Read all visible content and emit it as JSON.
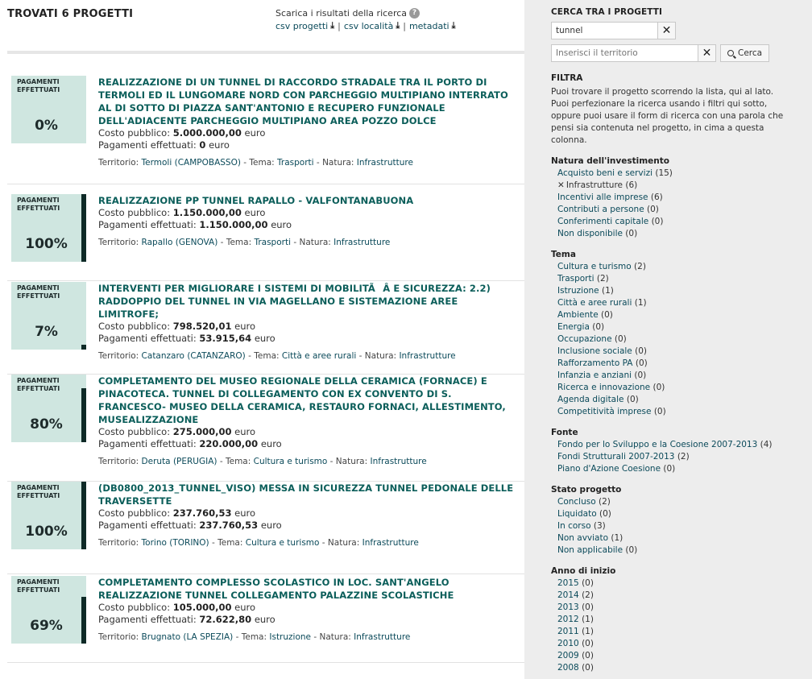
{
  "results": {
    "title": "TROVATI 6 PROGETTI",
    "download_label": "Scarica i risultati della ricerca",
    "help_icon": "?",
    "downloads": [
      {
        "label": "csv progetti",
        "icon": "download-icon"
      },
      {
        "label": "csv località",
        "icon": "download-icon"
      },
      {
        "label": "metadati",
        "icon": "download-icon"
      }
    ],
    "separator": "|"
  },
  "projects": [
    {
      "pct_label": "PAGAMENTI EFFETTUATI",
      "pct_text": "0%",
      "pct": 0,
      "title": "REALIZZAZIONE DI UN TUNNEL DI RACCORDO STRADALE TRA IL PORTO DI TERMOLI ED IL LUNGOMARE NORD CON PARCHEGGIO MULTIPIANO INTERRATO AL DI SOTTO DI PIAZZA SANT'ANTONIO E RECUPERO FUNZIONALE DELL'ADIACENTE PARCHEGGIO MULTIPIANO AREA POZZO DOLCE",
      "cost_label": "Costo pubblico:",
      "cost": "5.000.000,00",
      "paid_label": "Pagamenti effettuati:",
      "paid": "0",
      "currency": "euro",
      "territory_label": "Territorio:",
      "territory": "Termoli (CAMPOBASSO)",
      "theme_label": "Tema:",
      "theme": "Trasporti",
      "nature_label": "Natura:",
      "nature": "Infrastrutture"
    },
    {
      "pct_label": "PAGAMENTI EFFETTUATI",
      "pct_text": "100%",
      "pct": 100,
      "title": "REALIZZAZIONE PP TUNNEL RAPALLO - VALFONTANABUONA",
      "cost_label": "Costo pubblico:",
      "cost": "1.150.000,00",
      "paid_label": "Pagamenti effettuati:",
      "paid": "1.150.000,00",
      "currency": "euro",
      "territory_label": "Territorio:",
      "territory": "Rapallo (GENOVA)",
      "theme_label": "Tema:",
      "theme": "Trasporti",
      "nature_label": "Natura:",
      "nature": "Infrastrutture"
    },
    {
      "pct_label": "PAGAMENTI EFFETTUATI",
      "pct_text": "7%",
      "pct": 7,
      "title": "INTERVENTI PER MIGLIORARE I SISTEMI DI MOBILITÃÂ  E SICUREZZA: 2.2) RADDOPPIO DEL TUNNEL IN VIA MAGELLANO E SISTEMAZIONE AREE LIMITROFE;",
      "cost_label": "Costo pubblico:",
      "cost": "798.520,01",
      "paid_label": "Pagamenti effettuati:",
      "paid": "53.915,64",
      "currency": "euro",
      "territory_label": "Territorio:",
      "territory": "Catanzaro (CATANZARO)",
      "theme_label": "Tema:",
      "theme": "Città e aree rurali",
      "nature_label": "Natura:",
      "nature": "Infrastrutture"
    },
    {
      "pct_label": "PAGAMENTI EFFETTUATI",
      "pct_text": "80%",
      "pct": 80,
      "title": "COMPLETAMENTO DEL MUSEO REGIONALE DELLA CERAMICA (FORNACE) E PINACOTECA. TUNNEL DI COLLEGAMENTO CON EX CONVENTO DI S. FRANCESCO- MUSEO DELLA CERAMICA, RESTAURO FORNACI, ALLESTIMENTO, MUSEALIZZAZIONE",
      "cost_label": "Costo pubblico:",
      "cost": "275.000,00",
      "paid_label": "Pagamenti effettuati:",
      "paid": "220.000,00",
      "currency": "euro",
      "territory_label": "Territorio:",
      "territory": "Deruta (PERUGIA)",
      "theme_label": "Tema:",
      "theme": "Cultura e turismo",
      "nature_label": "Natura:",
      "nature": "Infrastrutture"
    },
    {
      "pct_label": "PAGAMENTI EFFETTUATI",
      "pct_text": "100%",
      "pct": 100,
      "title": "(DB0800_2013_TUNNEL_VISO) MESSA IN SICUREZZA TUNNEL PEDONALE DELLE TRAVERSETTE",
      "cost_label": "Costo pubblico:",
      "cost": "237.760,53",
      "paid_label": "Pagamenti effettuati:",
      "paid": "237.760,53",
      "currency": "euro",
      "territory_label": "Territorio:",
      "territory": "Torino (TORINO)",
      "theme_label": "Tema:",
      "theme": "Cultura e turismo",
      "nature_label": "Natura:",
      "nature": "Infrastrutture"
    },
    {
      "pct_label": "PAGAMENTI EFFETTUATI",
      "pct_text": "69%",
      "pct": 69,
      "title": "COMPLETAMENTO COMPLESSO SCOLASTICO IN LOC. SANT'ANGELO REALIZZAZIONE TUNNEL COLLEGAMENTO PALAZZINE SCOLASTICHE",
      "cost_label": "Costo pubblico:",
      "cost": "105.000,00",
      "paid_label": "Pagamenti effettuati:",
      "paid": "72.622,80",
      "currency": "euro",
      "territory_label": "Territorio:",
      "territory": "Brugnato (LA SPEZIA)",
      "theme_label": "Tema:",
      "theme": "Istruzione",
      "nature_label": "Natura:",
      "nature": "Infrastrutture"
    }
  ],
  "sidebar": {
    "search_heading": "CERCA TRA I PROGETTI",
    "search_value": "tunnel",
    "territory_placeholder": "Inserisci il territorio",
    "clear_glyph": "✕",
    "search_button": "Cerca",
    "filter_heading": "FILTRA",
    "filter_description": "Puoi trovare il progetto scorrendo la lista, qui al lato. Puoi perfezionare la ricerca usando i filtri qui sotto, oppure puoi usare il form di ricerca con una parola che pensi sia contenuta nel progetto, in cima a questa colonna.",
    "facets": [
      {
        "title": "Natura dell'investimento",
        "items": [
          {
            "label": "Acquisto beni e servizi",
            "count": "(15)",
            "selected": false
          },
          {
            "label": "Infrastrutture",
            "count": "(6)",
            "selected": true
          },
          {
            "label": "Incentivi alle imprese",
            "count": "(6)",
            "selected": false
          },
          {
            "label": "Contributi a persone",
            "count": "(0)",
            "selected": false
          },
          {
            "label": "Conferimenti capitale",
            "count": "(0)",
            "selected": false
          },
          {
            "label": "Non disponibile",
            "count": "(0)",
            "selected": false
          }
        ]
      },
      {
        "title": "Tema",
        "items": [
          {
            "label": "Cultura e turismo",
            "count": "(2)",
            "selected": false
          },
          {
            "label": "Trasporti",
            "count": "(2)",
            "selected": false
          },
          {
            "label": "Istruzione",
            "count": "(1)",
            "selected": false
          },
          {
            "label": "Città e aree rurali",
            "count": "(1)",
            "selected": false
          },
          {
            "label": "Ambiente",
            "count": "(0)",
            "selected": false
          },
          {
            "label": "Energia",
            "count": "(0)",
            "selected": false
          },
          {
            "label": "Occupazione",
            "count": "(0)",
            "selected": false
          },
          {
            "label": "Inclusione sociale",
            "count": "(0)",
            "selected": false
          },
          {
            "label": "Rafforzamento PA",
            "count": "(0)",
            "selected": false
          },
          {
            "label": "Infanzia e anziani",
            "count": "(0)",
            "selected": false
          },
          {
            "label": "Ricerca e innovazione",
            "count": "(0)",
            "selected": false
          },
          {
            "label": "Agenda digitale",
            "count": "(0)",
            "selected": false
          },
          {
            "label": "Competitività imprese",
            "count": "(0)",
            "selected": false
          }
        ]
      },
      {
        "title": "Fonte",
        "items": [
          {
            "label": "Fondo per lo Sviluppo e la Coesione 2007-2013",
            "count": "(4)",
            "selected": false
          },
          {
            "label": "Fondi Strutturali 2007-2013",
            "count": "(2)",
            "selected": false
          },
          {
            "label": "Piano d'Azione Coesione",
            "count": "(0)",
            "selected": false
          }
        ]
      },
      {
        "title": "Stato progetto",
        "items": [
          {
            "label": "Concluso",
            "count": "(2)",
            "selected": false
          },
          {
            "label": "Liquidato",
            "count": "(0)",
            "selected": false
          },
          {
            "label": "In corso",
            "count": "(3)",
            "selected": false
          },
          {
            "label": "Non avviato",
            "count": "(1)",
            "selected": false
          },
          {
            "label": "Non applicabile",
            "count": "(0)",
            "selected": false
          }
        ]
      },
      {
        "title": "Anno di inizio",
        "items": [
          {
            "label": "2015",
            "count": "(0)",
            "selected": false
          },
          {
            "label": "2014",
            "count": "(2)",
            "selected": false
          },
          {
            "label": "2013",
            "count": "(0)",
            "selected": false
          },
          {
            "label": "2012",
            "count": "(1)",
            "selected": false
          },
          {
            "label": "2011",
            "count": "(1)",
            "selected": false
          },
          {
            "label": "2010",
            "count": "(0)",
            "selected": false
          },
          {
            "label": "2009",
            "count": "(0)",
            "selected": false
          },
          {
            "label": "2008",
            "count": "(0)",
            "selected": false
          }
        ]
      }
    ]
  }
}
